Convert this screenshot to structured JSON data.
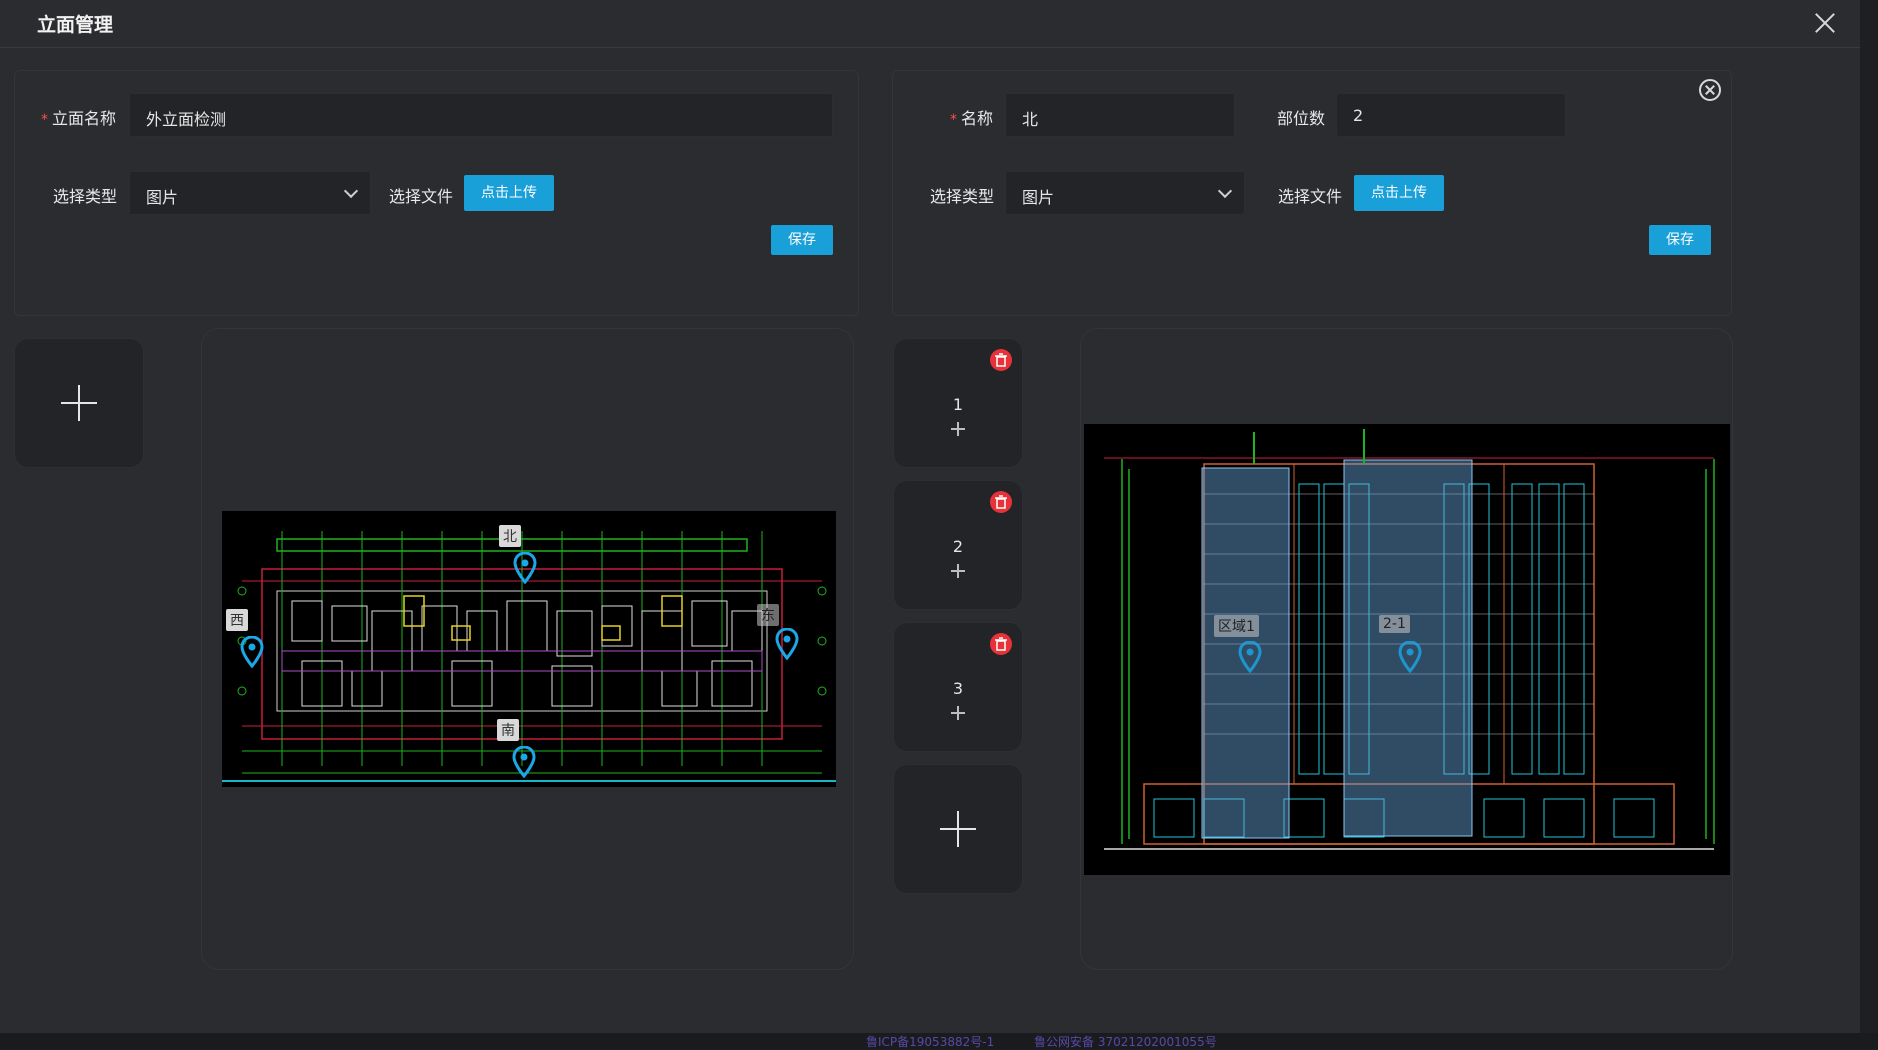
{
  "dialog": {
    "title": "立面管理"
  },
  "left_form": {
    "name_label": "立面名称",
    "name_value": "外立面检测",
    "type_label": "选择类型",
    "type_value": "图片",
    "file_label": "选择文件",
    "upload_label": "点击上传",
    "save_label": "保存"
  },
  "right_form": {
    "name_label": "名称",
    "name_value": "北",
    "parts_label": "部位数",
    "parts_value": "2",
    "type_label": "选择类型",
    "type_value": "图片",
    "file_label": "选择文件",
    "upload_label": "点击上传",
    "save_label": "保存"
  },
  "elevation_list": [
    {
      "label": "1"
    },
    {
      "label": "2"
    },
    {
      "label": "3"
    }
  ],
  "floor_plan_markers": [
    {
      "label": "北"
    },
    {
      "label": "西"
    },
    {
      "label": "东"
    },
    {
      "label": "南"
    }
  ],
  "elevation_markers": [
    {
      "label": "区域1"
    },
    {
      "label": "2-1"
    }
  ],
  "footer": {
    "icp": "鲁ICP备19053882号-1",
    "police": "鲁公网安备 37021202001055号"
  },
  "colors": {
    "accent": "#1aa0d8",
    "danger": "#e8323a",
    "pin": "#1aa8e8"
  }
}
